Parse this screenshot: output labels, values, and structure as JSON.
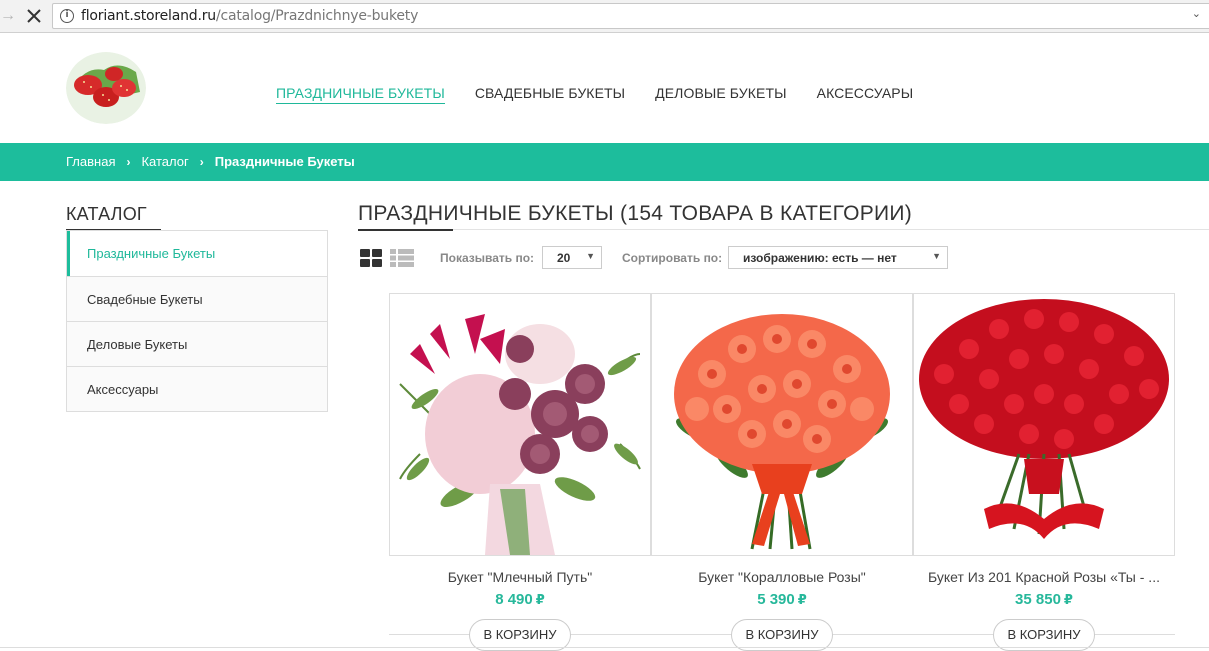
{
  "browser": {
    "url_host": "floriant.storeland.ru",
    "url_path": "/catalog/Prazdnichnye-bukety"
  },
  "nav": {
    "items": [
      {
        "label": "ПРАЗДНИЧНЫЕ БУКЕТЫ",
        "active": true
      },
      {
        "label": "СВАДЕБНЫЕ БУКЕТЫ",
        "active": false
      },
      {
        "label": "ДЕЛОВЫЕ БУКЕТЫ",
        "active": false
      },
      {
        "label": "АКСЕССУАРЫ",
        "active": false
      }
    ]
  },
  "breadcrumb": {
    "home": "Главная",
    "catalog": "Каталог",
    "current": "Праздничные Букеты"
  },
  "sidebar": {
    "title": "КАТАЛОГ",
    "items": [
      {
        "label": "Праздничные Букеты",
        "active": true
      },
      {
        "label": "Свадебные Букеты",
        "active": false
      },
      {
        "label": "Деловые Букеты",
        "active": false
      },
      {
        "label": "Аксессуары",
        "active": false
      }
    ]
  },
  "main": {
    "title": "ПРАЗДНИЧНЫЕ БУКЕТЫ (154 ТОВАРА В КАТЕГОРИИ)",
    "show_label": "Показывать по:",
    "show_value": "20",
    "sort_label": "Сортировать по:",
    "sort_value": "изображению: есть — нет"
  },
  "products": [
    {
      "name": "Букет \"Млечный Путь\"",
      "price": "8 490",
      "currency": "₽",
      "button": "В КОРЗИНУ",
      "image": "bouquet-pink-roses-hydrangea"
    },
    {
      "name": "Букет \"Коралловые Розы\"",
      "price": "5 390",
      "currency": "₽",
      "button": "В КОРЗИНУ",
      "image": "bouquet-coral-roses"
    },
    {
      "name": "Букет Из 201 Красной Розы «Ты - ...",
      "price": "35 850",
      "currency": "₽",
      "button": "В КОРЗИНУ",
      "image": "bouquet-red-roses"
    }
  ],
  "colors": {
    "accent": "#1dbd9c",
    "price": "#27b89b"
  }
}
